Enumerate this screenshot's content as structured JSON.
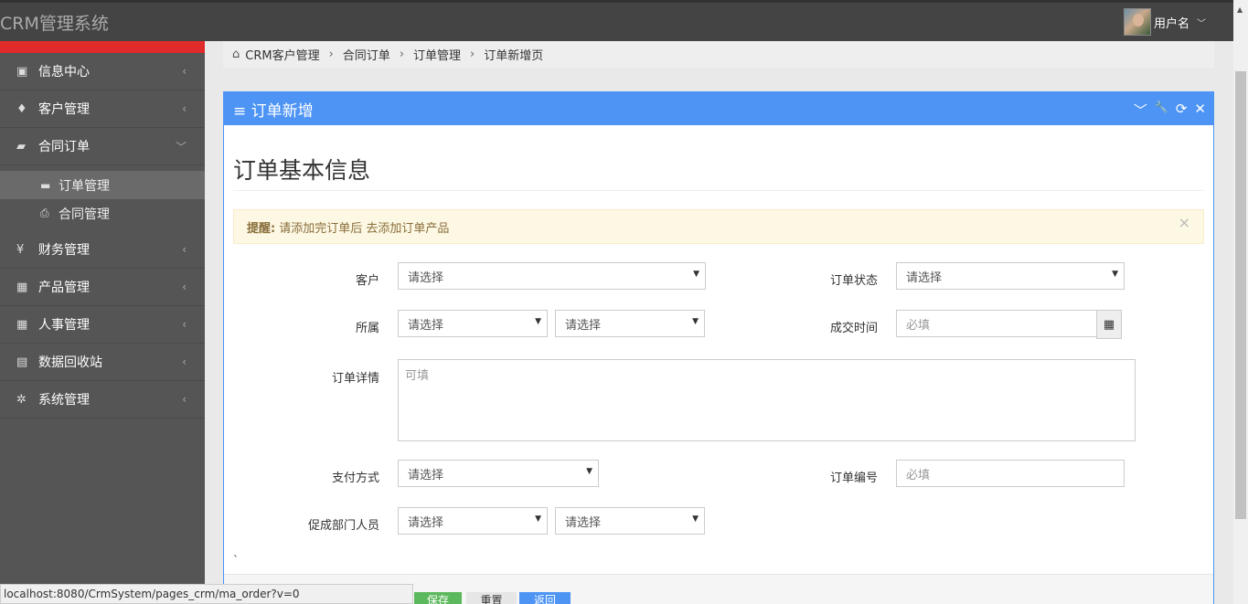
{
  "header": {
    "app_title": "CRM管理系统",
    "username": "用户名",
    "chevron": "﹀"
  },
  "sidebar": {
    "items": [
      {
        "icon": "dashboard-icon",
        "glyph": "▣",
        "label": "信息中心",
        "arrow": "‹"
      },
      {
        "icon": "person-icon",
        "glyph": "♦",
        "label": "客户管理",
        "arrow": "‹"
      },
      {
        "icon": "book-icon",
        "glyph": "▰",
        "label": "合同订单",
        "arrow": "﹀"
      },
      {
        "icon": "yen-icon",
        "glyph": "¥",
        "label": "财务管理",
        "arrow": "‹"
      },
      {
        "icon": "table-icon",
        "glyph": "▦",
        "label": "产品管理",
        "arrow": "‹"
      },
      {
        "icon": "table-icon",
        "glyph": "▦",
        "label": "人事管理",
        "arrow": "‹"
      },
      {
        "icon": "trash-icon",
        "glyph": "▤",
        "label": "数据回收站",
        "arrow": "‹"
      },
      {
        "icon": "gear-icon",
        "glyph": "✲",
        "label": "系统管理",
        "arrow": "‹"
      }
    ],
    "subitems": [
      {
        "icon": "folder-icon",
        "glyph": "▬",
        "label": "订单管理",
        "active": true
      },
      {
        "icon": "printer-icon",
        "glyph": "⎙",
        "label": "合同管理",
        "active": false
      }
    ]
  },
  "breadcrumb": {
    "home_glyph": "⌂",
    "items": [
      "CRM客户管理",
      "合同订单",
      "订单管理",
      "订单新增页"
    ],
    "sep": "›"
  },
  "panel": {
    "title": "≡ 订单新增",
    "tools": [
      "﹀",
      "🔧",
      "⟳",
      "✕"
    ],
    "section_title": "订单基本信息",
    "alert": {
      "bold": "提醒:",
      "text": "请添加完订单后 去添加订单产品",
      "close": "×"
    },
    "form": {
      "customer": {
        "label": "客户",
        "value": "请选择"
      },
      "order_status": {
        "label": "订单状态",
        "value": "请选择"
      },
      "belong": {
        "label": "所属",
        "value1": "请选择",
        "value2": "请选择"
      },
      "deal_time": {
        "label": "成交时间",
        "placeholder": "必填",
        "cal_glyph": "▦"
      },
      "detail": {
        "label": "订单详情",
        "placeholder": "可填"
      },
      "payment": {
        "label": "支付方式",
        "value": "请选择"
      },
      "order_no": {
        "label": "订单编号",
        "placeholder": "必填"
      },
      "promoter": {
        "label": "促成部门人员",
        "value1": "请选择",
        "value2": "请选择"
      }
    },
    "tick": "`",
    "buttons": [
      {
        "label": "保存",
        "color": "#5cb85c"
      },
      {
        "label": "重置",
        "color": "#e6e6e6"
      },
      {
        "label": "返回",
        "color": "#4d94f5"
      }
    ]
  },
  "statusbar": {
    "url": "localhost:8080/CrmSystem/pages_crm/ma_order?v=0"
  }
}
